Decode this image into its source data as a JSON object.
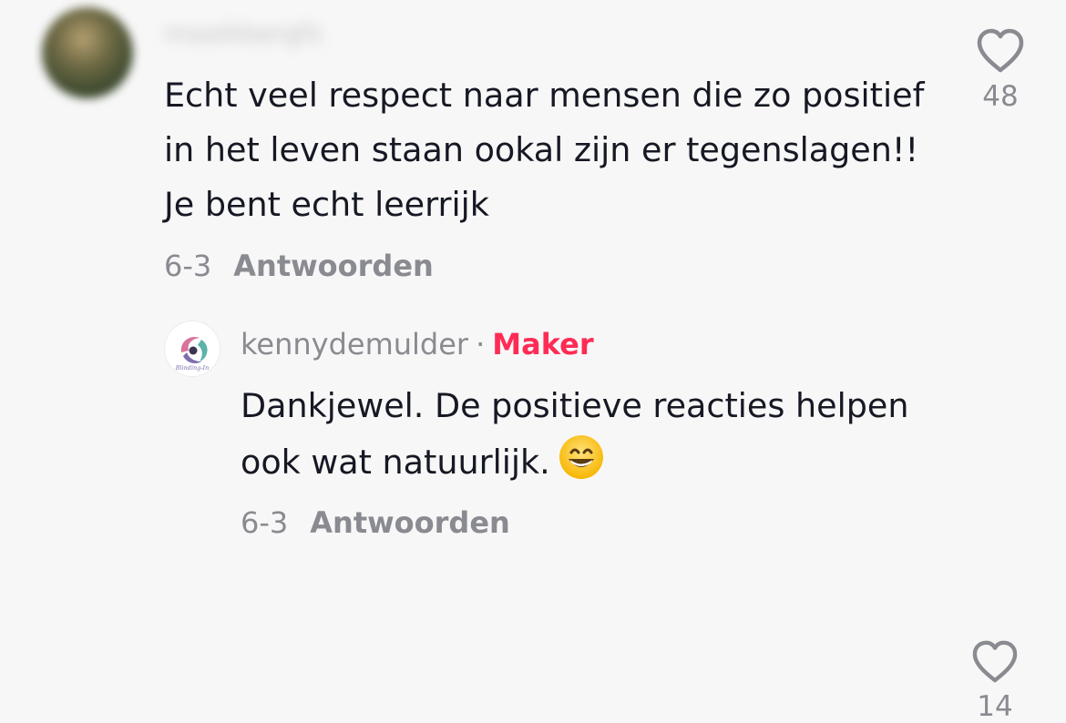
{
  "comment": {
    "username_blurred": "maaikbergfs",
    "text": "Echt veel respect naar mensen die zo positief in het leven staan ookal zijn er tegenslagen!! Je bent echt leerrijk",
    "date": "6-3",
    "reply_label": "Antwoorden",
    "like_count": "48"
  },
  "reply": {
    "username": "kennydemulder",
    "separator": "·",
    "badge": "Maker",
    "avatar_logo_text": "Blinding-In",
    "text": "Dankjewel. De positieve reacties helpen ook wat natuurlijk.",
    "emoji": "grinning-face-with-smiling-eyes",
    "date": "6-3",
    "reply_label": "Antwoorden",
    "like_count": "14"
  },
  "colors": {
    "background": "#f7f7f7",
    "text": "#161823",
    "muted": "#8a8b91",
    "maker": "#fe2c55",
    "heart_outline": "#8a8b91"
  },
  "icons": {
    "like": "heart-outline-icon"
  }
}
